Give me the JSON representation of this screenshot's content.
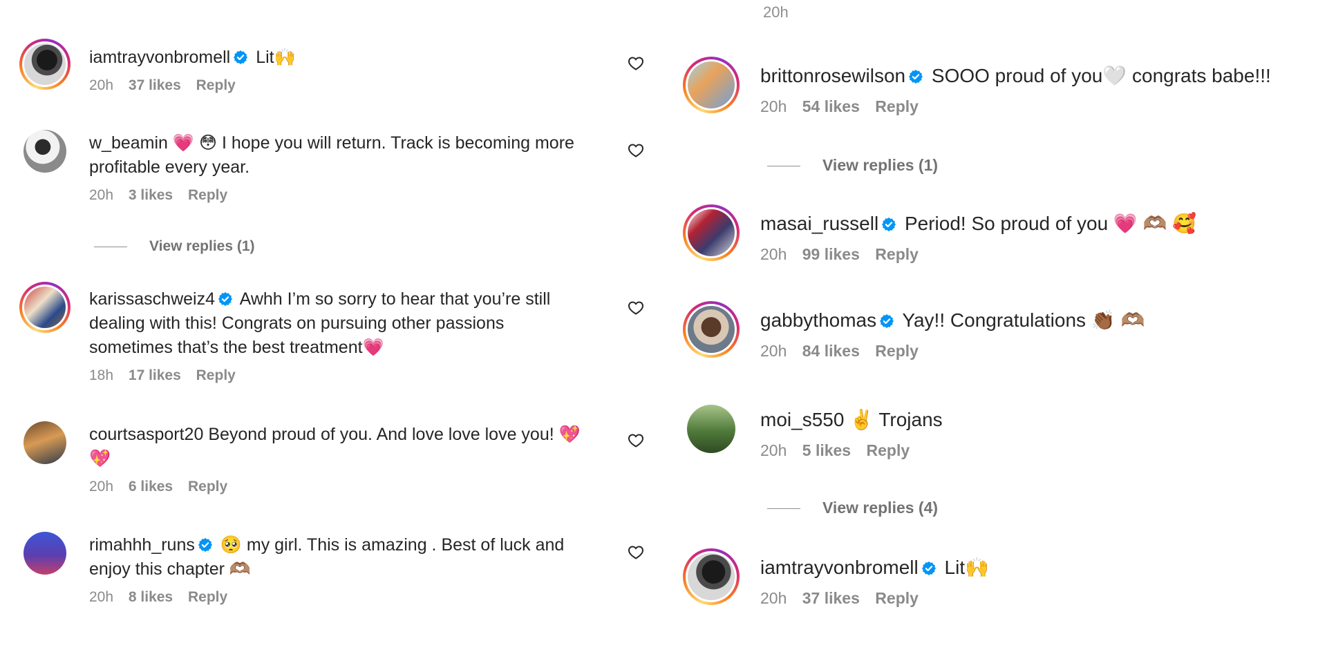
{
  "left_column": {
    "comments": [
      {
        "username": "iamtrayvonbromell",
        "verified": true,
        "text": "Lit🙌",
        "time": "20h",
        "likes": "37 likes",
        "reply": "Reply"
      },
      {
        "username": "w_beamin",
        "verified": false,
        "text": "💗 😳 I hope you will return. Track is becoming more profitable every year.",
        "time": "20h",
        "likes": "3 likes",
        "reply": "Reply",
        "view_replies": "View replies (1)"
      },
      {
        "username": "karissaschweiz4",
        "verified": true,
        "text": "Awhh I’m so sorry to hear that you’re still dealing with this! Congrats on pursuing other passions sometimes that’s the best treatment💗",
        "time": "18h",
        "likes": "17 likes",
        "reply": "Reply"
      },
      {
        "username": "courtsasport20",
        "verified": false,
        "text": "Beyond proud of you. And love love love you! 💖 💖",
        "time": "20h",
        "likes": "6 likes",
        "reply": "Reply"
      },
      {
        "username": "rimahhh_runs",
        "verified": true,
        "text": "🥺 my girl. This is amazing . Best of luck and enjoy this chapter 🫶🏽",
        "time": "20h",
        "likes": "8 likes",
        "reply": "Reply"
      }
    ]
  },
  "right_column": {
    "cutoff_time": "20h",
    "comments": [
      {
        "username": "brittonrosewilson",
        "verified": true,
        "text": "SOOO proud of you🤍 congrats babe!!!",
        "time": "20h",
        "likes": "54 likes",
        "reply": "Reply",
        "view_replies": "View replies (1)"
      },
      {
        "username": "masai_russell",
        "verified": true,
        "text": "Period! So proud of you 💗 🫶🏽 🥰",
        "time": "20h",
        "likes": "99 likes",
        "reply": "Reply"
      },
      {
        "username": "gabbythomas",
        "verified": true,
        "text": "Yay!! Congratulations 👏🏾 🫶🏽",
        "time": "20h",
        "likes": "84 likes",
        "reply": "Reply"
      },
      {
        "username": "moi_s550",
        "verified": false,
        "text": "✌️ Trojans",
        "time": "20h",
        "likes": "5 likes",
        "reply": "Reply",
        "view_replies": "View replies (4)"
      },
      {
        "username": "iamtrayvonbromell",
        "verified": true,
        "text": "Lit🙌",
        "time": "20h",
        "likes": "37 likes",
        "reply": "Reply"
      }
    ]
  },
  "colors": {
    "text": "#262626",
    "meta": "#737373",
    "verified": "#0095f6",
    "story_ring_start": "#feda75",
    "story_ring_end": "#962fbf"
  },
  "icons": {
    "verified": "verified-badge-icon",
    "like": "heart-outline-icon"
  }
}
